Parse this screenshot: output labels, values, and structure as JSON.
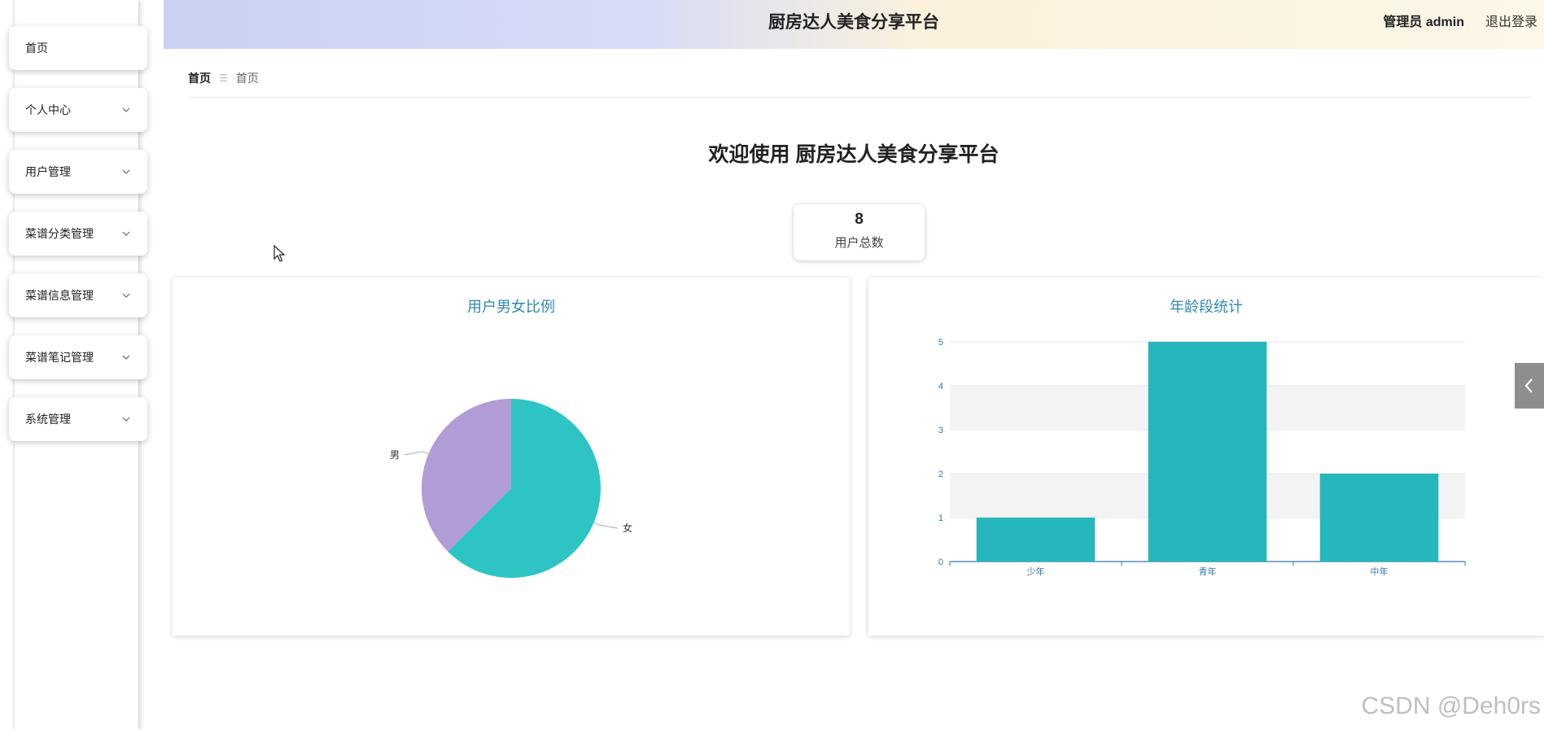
{
  "header": {
    "title": "厨房达人美食分享平台",
    "user_label": "管理员 admin",
    "logout_label": "退出登录"
  },
  "sidebar": {
    "items": [
      {
        "label": "首页",
        "has_children": false
      },
      {
        "label": "个人中心",
        "has_children": true
      },
      {
        "label": "用户管理",
        "has_children": true
      },
      {
        "label": "菜谱分类管理",
        "has_children": true
      },
      {
        "label": "菜谱信息管理",
        "has_children": true
      },
      {
        "label": "菜谱笔记管理",
        "has_children": true
      },
      {
        "label": "系统管理",
        "has_children": true
      }
    ]
  },
  "breadcrumb": {
    "first": "首页",
    "separator": "☰",
    "current": "首页"
  },
  "welcome": "欢迎使用 厨房达人美食分享平台",
  "stat": {
    "value": "8",
    "label": "用户总数"
  },
  "colors": {
    "teal": "#26b7bc",
    "pie_female": "#2ec4c4",
    "pie_male": "#b29cd6",
    "title_blue": "#2f8ab4",
    "axis_blue": "#2f78a8"
  },
  "chart_data": [
    {
      "type": "pie",
      "title": "用户男女比例",
      "slices": [
        {
          "name": "女",
          "value": 5
        },
        {
          "name": "男",
          "value": 3
        }
      ]
    },
    {
      "type": "bar",
      "title": "年龄段统计",
      "categories": [
        "少年",
        "青年",
        "中年"
      ],
      "values": [
        1,
        5,
        2
      ],
      "ylim": [
        0,
        5
      ],
      "yticks": [
        0,
        1,
        2,
        3,
        4,
        5
      ],
      "grid": true
    }
  ],
  "watermark": "CSDN @Deh0rs"
}
